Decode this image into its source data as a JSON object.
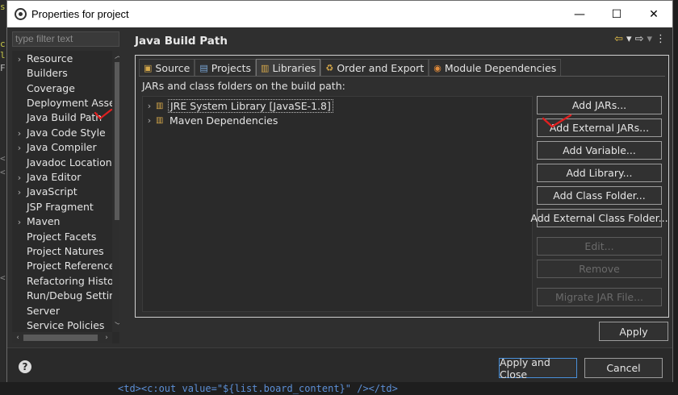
{
  "background": {
    "left_gutter": [
      "s",
      "c",
      "l",
      "F",
      "<",
      "<",
      "<"
    ],
    "bottom_code": {
      "open_tag": "<td>",
      "inner": "<c:out value=\"${list.board_content}\" />",
      "close_tag": "</td>"
    }
  },
  "window": {
    "title": "Properties for project",
    "minimize": "—",
    "maximize": "☐",
    "close": "✕"
  },
  "sidebar": {
    "filter_placeholder": "type filter text",
    "items": [
      {
        "label": "Resource",
        "twisty": "›"
      },
      {
        "label": "Builders",
        "twisty": ""
      },
      {
        "label": "Coverage",
        "twisty": ""
      },
      {
        "label": "Deployment Assembly",
        "twisty": ""
      },
      {
        "label": "Java Build Path",
        "twisty": ""
      },
      {
        "label": "Java Code Style",
        "twisty": "›"
      },
      {
        "label": "Java Compiler",
        "twisty": "›"
      },
      {
        "label": "Javadoc Location",
        "twisty": ""
      },
      {
        "label": "Java Editor",
        "twisty": "›"
      },
      {
        "label": "JavaScript",
        "twisty": "›"
      },
      {
        "label": "JSP Fragment",
        "twisty": ""
      },
      {
        "label": "Maven",
        "twisty": "›"
      },
      {
        "label": "Project Facets",
        "twisty": ""
      },
      {
        "label": "Project Natures",
        "twisty": ""
      },
      {
        "label": "Project References",
        "twisty": ""
      },
      {
        "label": "Refactoring History",
        "twisty": ""
      },
      {
        "label": "Run/Debug Settings",
        "twisty": ""
      },
      {
        "label": "Server",
        "twisty": ""
      },
      {
        "label": "Service Policies",
        "twisty": ""
      }
    ]
  },
  "page": {
    "title": "Java Build Path",
    "tabs": [
      {
        "label": "Source",
        "icon": "▣"
      },
      {
        "label": "Projects",
        "icon": "▤"
      },
      {
        "label": "Libraries",
        "icon": "▥"
      },
      {
        "label": "Order and Export",
        "icon": "♻"
      },
      {
        "label": "Module Dependencies",
        "icon": "◉"
      }
    ],
    "active_tab": "Libraries",
    "caption": "JARs and class folders on the build path:",
    "entries": [
      {
        "label": "JRE System Library [JavaSE-1.8]"
      },
      {
        "label": "Maven Dependencies"
      }
    ],
    "buttons": {
      "add_jars": "Add JARs...",
      "add_external_jars": "Add External JARs...",
      "add_variable": "Add Variable...",
      "add_library": "Add Library...",
      "add_class_folder": "Add Class Folder...",
      "add_external_class_folder": "Add External Class Folder...",
      "edit": "Edit...",
      "remove": "Remove",
      "migrate_jar": "Migrate JAR File..."
    },
    "apply": "Apply"
  },
  "footer": {
    "help": "?",
    "apply_and_close": "Apply and Close",
    "cancel": "Cancel"
  },
  "colors": {
    "annotation": "#e02020",
    "focus": "#4a90d9"
  }
}
